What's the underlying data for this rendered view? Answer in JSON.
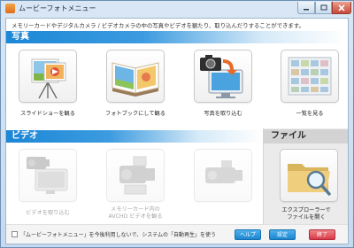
{
  "window": {
    "title": "ムービーフォトメニュー",
    "icon": "app-icon",
    "controls": [
      "minimize-icon",
      "maximize-icon",
      "close-icon"
    ]
  },
  "description": "メモリーカードやデジタルカメラ / ビデオカメラの中の写真やビデオを観たり、取り込んだりすることができます。",
  "photo": {
    "heading": "写真",
    "items": [
      {
        "label": "スライドショーを観る",
        "icon": "slideshow-icon"
      },
      {
        "label": "フォトブックにして観る",
        "icon": "photobook-icon"
      },
      {
        "label": "写真を取り込む",
        "icon": "import-photos-icon"
      },
      {
        "label": "一覧を見る",
        "icon": "thumbnail-grid-icon"
      }
    ]
  },
  "video": {
    "heading": "ビデオ",
    "items": [
      {
        "label": "ビデオを取り込む",
        "icon": "import-video-icon",
        "enabled": false
      },
      {
        "label_line1": "メモリーカード内の",
        "label_line2": "AVCHD ビデオを観る",
        "icon": "avchd-camera-icon",
        "enabled": false
      },
      {
        "label": "",
        "icon": "camcorder-icon",
        "enabled": false
      }
    ]
  },
  "file": {
    "heading": "ファイル",
    "item": {
      "label_line1": "エクスプローラーで",
      "label_line2": "ファイルを開く",
      "icon": "folder-search-icon"
    }
  },
  "footer": {
    "checkbox_label": "「ムービーフォトメニュー」を今後利用しないで、システムの「自動再生」を使う",
    "checked": false,
    "help": "ヘルプ",
    "settings": "設定",
    "exit": "終了"
  },
  "colors": {
    "section_blue": "#1c87d6",
    "button_blue": "#1c86cf",
    "button_red": "#d9394a"
  }
}
